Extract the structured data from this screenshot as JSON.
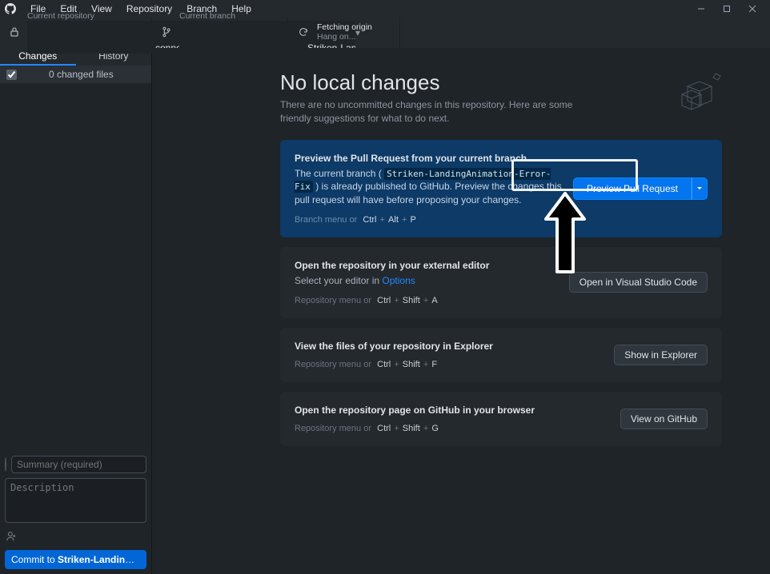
{
  "menu": [
    "File",
    "Edit",
    "View",
    "Repository",
    "Branch",
    "Help"
  ],
  "repo": {
    "label": "Current repository",
    "name": "connect-ed-foraging"
  },
  "branch": {
    "label": "Current branch",
    "name": "Striken-LandingAnimation..."
  },
  "fetch": {
    "label": "Fetching origin",
    "status": "Hang on..."
  },
  "tabs": {
    "changes": "Changes",
    "history": "History"
  },
  "changed": "0 changed files",
  "commit": {
    "summary_ph": "Summary (required)",
    "desc_ph": "Description",
    "button_pre": "Commit to ",
    "button_branch": "Striken-LandingAnimati..."
  },
  "main": {
    "title": "No local changes",
    "subtitle": "There are no uncommitted changes in this repository. Here are some friendly suggestions for what to do next."
  },
  "cards": {
    "pr": {
      "title": "Preview the Pull Request from your current branch",
      "desc_pre": "The current branch ( ",
      "code": "Striken-LandingAnimation-Error-Fix",
      "desc_post": " ) is already published to GitHub. Preview the changes this pull request will have before proposing your changes.",
      "hint": "Branch menu or",
      "k1": "Ctrl",
      "k2": "Alt",
      "k3": "P",
      "btn": "Preview Pull Request"
    },
    "editor": {
      "title": "Open the repository in your external editor",
      "desc_pre": "Select your editor in ",
      "link": "Options",
      "hint": "Repository menu or",
      "k1": "Ctrl",
      "k2": "Shift",
      "k3": "A",
      "btn": "Open in Visual Studio Code"
    },
    "explorer": {
      "title": "View the files of your repository in Explorer",
      "hint": "Repository menu or",
      "k1": "Ctrl",
      "k2": "Shift",
      "k3": "F",
      "btn": "Show in Explorer"
    },
    "github": {
      "title": "Open the repository page on GitHub in your browser",
      "hint": "Repository menu or",
      "k1": "Ctrl",
      "k2": "Shift",
      "k3": "G",
      "btn": "View on GitHub"
    }
  }
}
